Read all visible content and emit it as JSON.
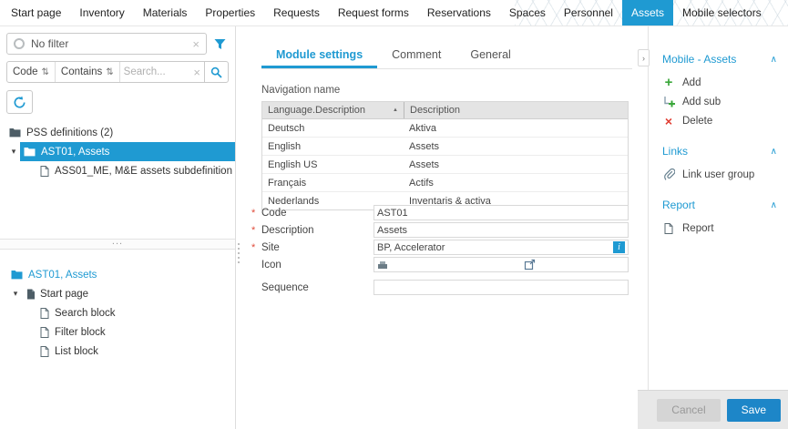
{
  "topnav": {
    "items": [
      {
        "label": "Start page"
      },
      {
        "label": "Inventory"
      },
      {
        "label": "Materials"
      },
      {
        "label": "Properties"
      },
      {
        "label": "Requests"
      },
      {
        "label": "Request forms"
      },
      {
        "label": "Reservations"
      },
      {
        "label": "Spaces"
      },
      {
        "label": "Personnel"
      },
      {
        "label": "Assets"
      },
      {
        "label": "Mobile selectors"
      }
    ],
    "active": "Assets"
  },
  "sidebar": {
    "filter_bar": {
      "value": "No filter"
    },
    "search_bar": {
      "field": "Code",
      "operator": "Contains",
      "placeholder": "Search..."
    },
    "tree": {
      "root": "PSS definitions (2)",
      "selected": "AST01, Assets",
      "child": "ASS01_ME, M&E assets subdefinition"
    },
    "subtree": {
      "root": "AST01, Assets",
      "node": "Start page",
      "children": [
        {
          "label": "Search block"
        },
        {
          "label": "Filter block"
        },
        {
          "label": "List block"
        }
      ]
    }
  },
  "main": {
    "tabs": [
      {
        "label": "Module settings"
      },
      {
        "label": "Comment"
      },
      {
        "label": "General"
      }
    ],
    "active_tab": "Module settings",
    "section_label": "Navigation name",
    "table": {
      "headers": [
        {
          "label": "Language.Description"
        },
        {
          "label": "Description"
        }
      ],
      "rows": [
        {
          "lang": "Deutsch",
          "desc": "Aktiva"
        },
        {
          "lang": "English",
          "desc": "Assets"
        },
        {
          "lang": "English US",
          "desc": "Assets"
        },
        {
          "lang": "Français",
          "desc": "Actifs"
        },
        {
          "lang": "Nederlands",
          "desc": "Inventaris & activa"
        }
      ]
    },
    "fields": [
      {
        "label": "Code",
        "value": "AST01",
        "required": "*"
      },
      {
        "label": "Description",
        "value": "Assets",
        "required": "*"
      },
      {
        "label": "Site",
        "value": "BP, Accelerator",
        "required": "*",
        "info": "i"
      },
      {
        "label": "Icon",
        "value": ""
      },
      {
        "label": "Sequence",
        "value": ""
      }
    ]
  },
  "actions": {
    "sections": [
      {
        "title": "Mobile - Assets",
        "items": [
          {
            "label": "Add"
          },
          {
            "label": "Add sub"
          },
          {
            "label": "Delete"
          }
        ]
      },
      {
        "title": "Links",
        "items": [
          {
            "label": "Link user group"
          }
        ]
      },
      {
        "title": "Report",
        "items": [
          {
            "label": "Report"
          }
        ]
      }
    ]
  },
  "footer": {
    "cancel_label": "Cancel",
    "save_label": "Save"
  },
  "icons": {
    "clear": "×",
    "sort": "⇅",
    "caret_down": "▾",
    "sort_asc": "▲",
    "chevron_up": "∧",
    "collapse_right": "›",
    "plus": "+",
    "delete_x": "×",
    "splitter_dots": "..."
  },
  "colors": {
    "accent": "#1f9ad2",
    "save_button": "#1d86c8",
    "add_green": "#3aa73a",
    "delete_red": "#e03c31"
  }
}
